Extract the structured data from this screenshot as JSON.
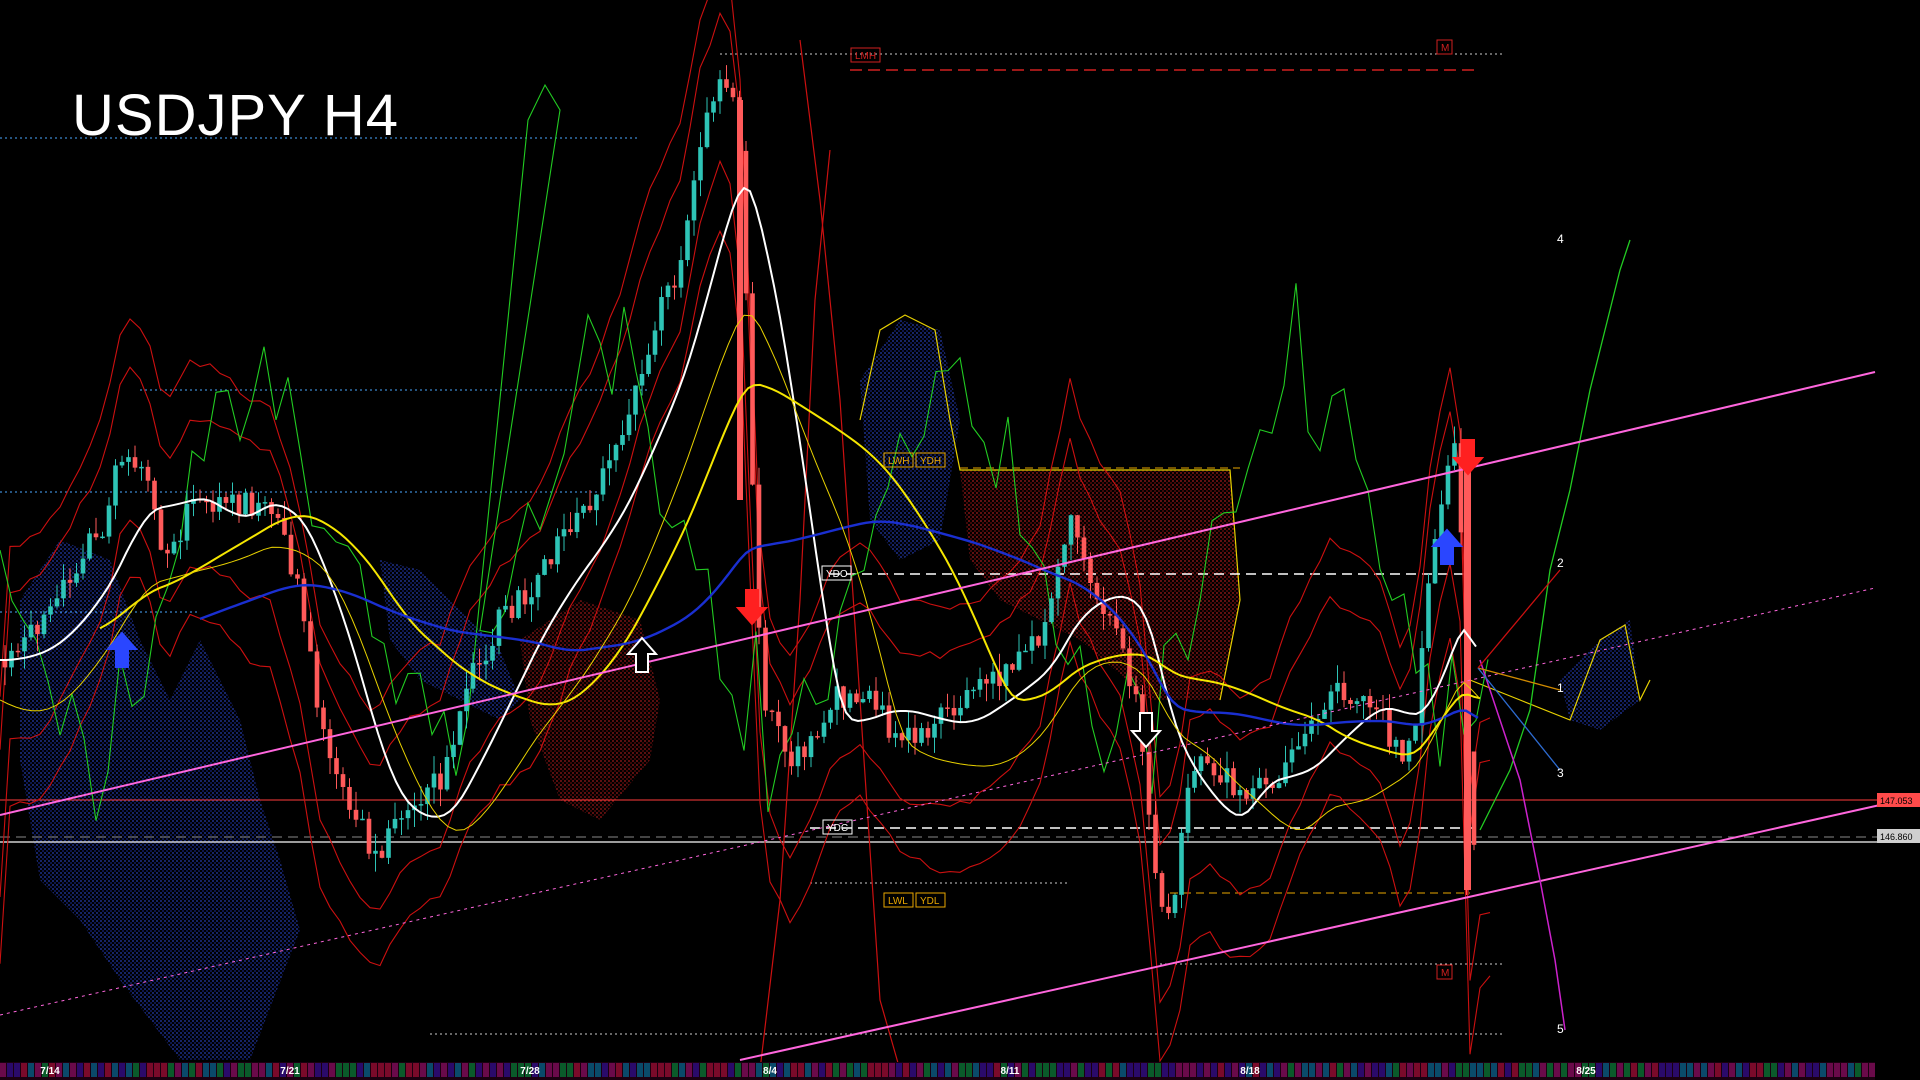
{
  "chart": {
    "title": "USDJPY H4",
    "background": "#000000"
  },
  "chart_data": {
    "type": "line",
    "title": "USDJPY H4",
    "x_axis": {
      "ticks": [
        "7/14",
        "7/21",
        "7/28",
        "8/4",
        "8/11",
        "8/18",
        "8/25"
      ]
    },
    "y_axis": {
      "markers": [
        {
          "label": "147.053",
          "color": "#ff4a4a"
        },
        {
          "label": "146.860",
          "color": "#cfcfcf"
        }
      ]
    },
    "level_labels": [
      {
        "text": "LMH",
        "color": "#d02020"
      },
      {
        "text": "M",
        "color": "#d02020"
      },
      {
        "text": "LWH",
        "color": "#e8a600"
      },
      {
        "text": "YDH",
        "color": "#e8a600"
      },
      {
        "text": "YDO",
        "color": "#ffffff"
      },
      {
        "text": "YDC",
        "color": "#ffffff"
      },
      {
        "text": "LWL",
        "color": "#e8a600"
      },
      {
        "text": "YDL",
        "color": "#e8a600"
      },
      {
        "text": "M",
        "color": "#d02020"
      }
    ],
    "projection_labels": [
      "4",
      "2",
      "1",
      "3",
      "5"
    ],
    "signals": [
      {
        "type": "buy",
        "style": "blue-arrow"
      },
      {
        "type": "buy",
        "style": "white-outline-arrow"
      },
      {
        "type": "sell",
        "style": "red-arrow"
      },
      {
        "type": "sell",
        "style": "white-outline-arrow"
      },
      {
        "type": "buy",
        "style": "blue-arrow"
      },
      {
        "type": "sell",
        "style": "red-arrow"
      }
    ],
    "colors": {
      "bull_candle": "#2ec4b6",
      "bear_candle": "#ff5a5a",
      "channel": "#ff66dd",
      "ma_white": "#ffffff",
      "ma_yellow": "#f5e600",
      "ma_blue": "#1a2fd0",
      "oscillator": "#22cc22",
      "bands": "#cc1010",
      "cloud": "#2233aa"
    }
  }
}
